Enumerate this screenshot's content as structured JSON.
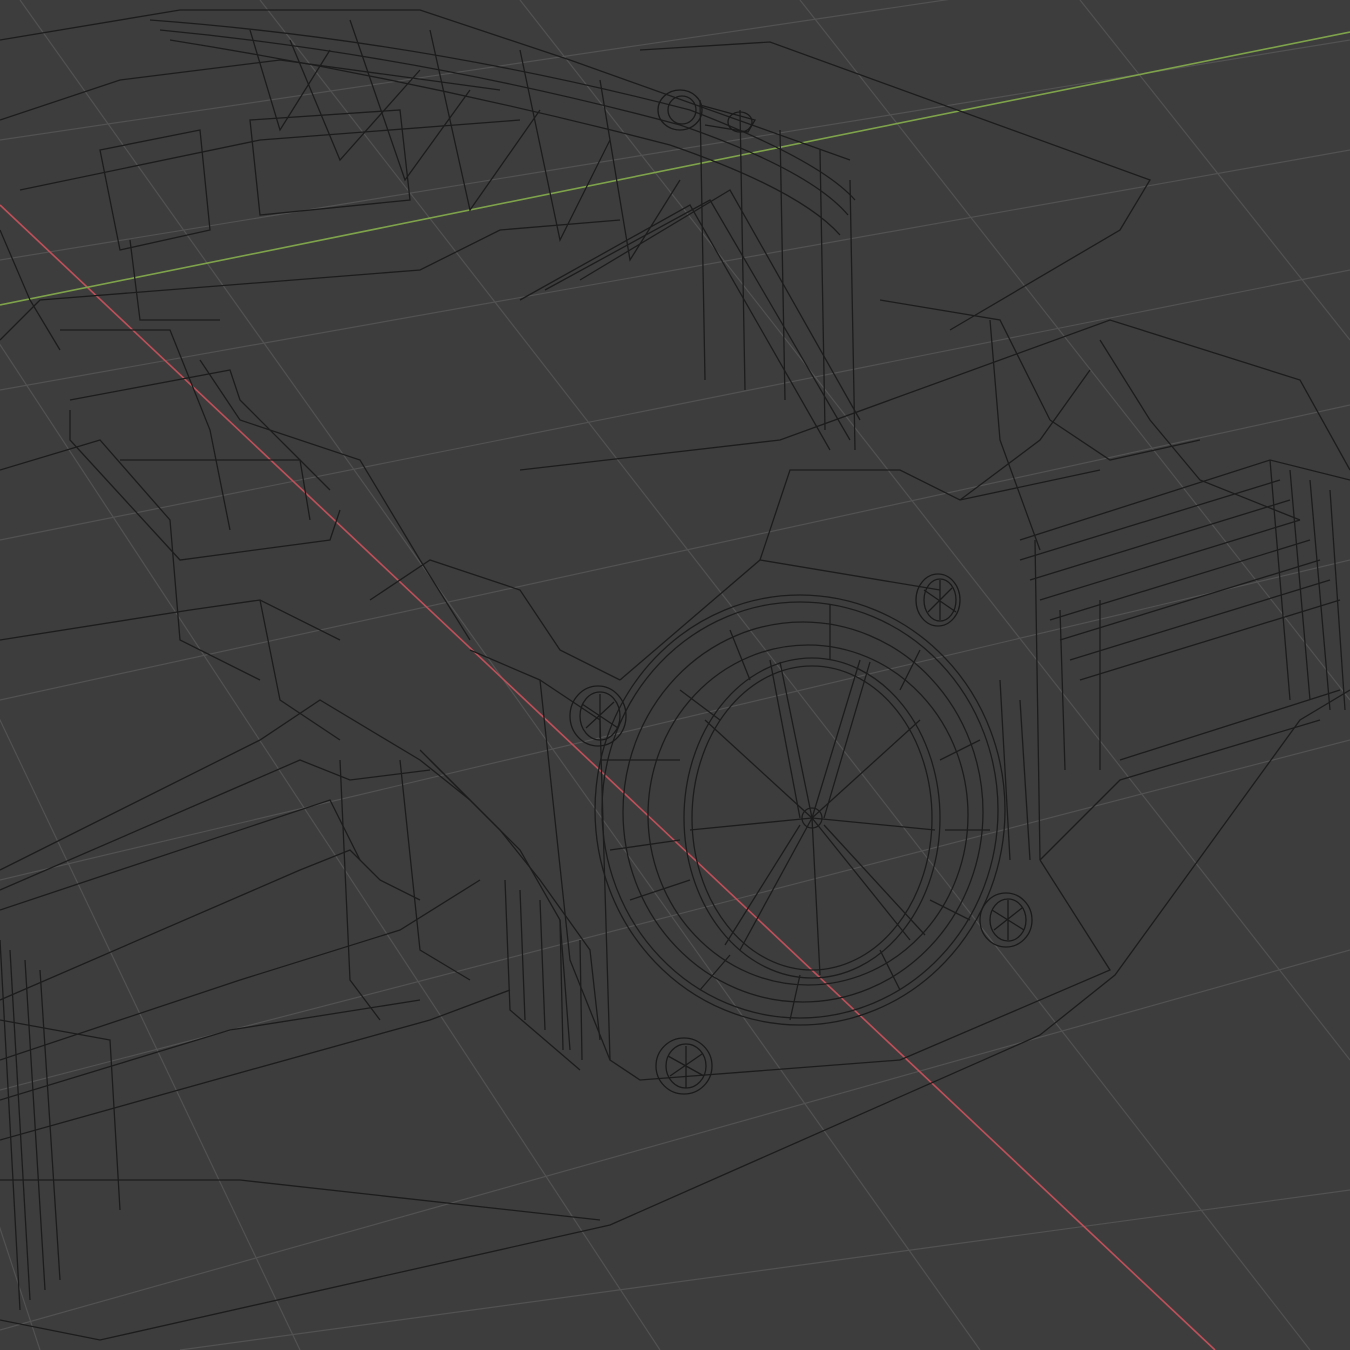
{
  "viewport": {
    "mode": "wireframe",
    "background": "#3d3d3d",
    "grid_color": "#525252",
    "x_axis_color": "#c0505a",
    "y_axis_color": "#7ea34a",
    "wire_color": "#1c1c1c"
  },
  "scene": {
    "object": "spaceship-hull-wireframe",
    "main_rotor": "central-turbine-ring",
    "small_thrusters": 5
  }
}
